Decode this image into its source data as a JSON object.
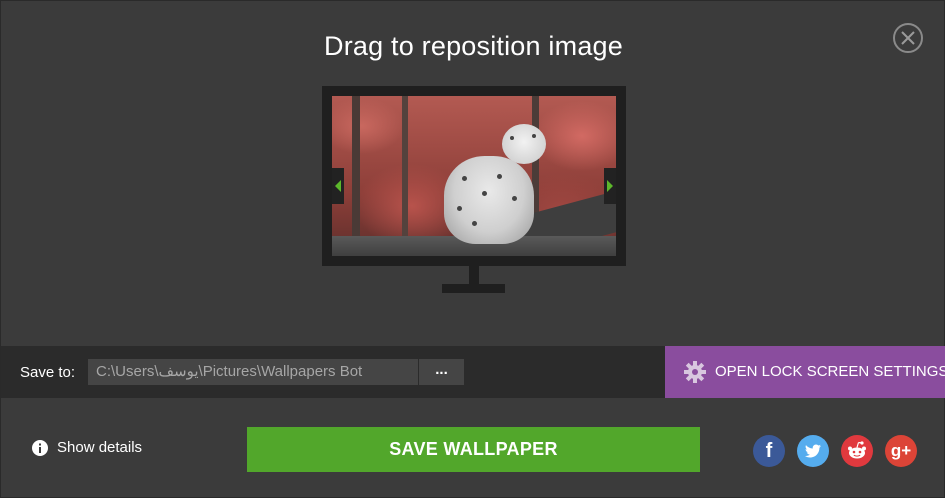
{
  "dialog": {
    "title": "Drag to reposition image"
  },
  "icons": {
    "close": "close-icon",
    "left_arrow": "chevron-left-icon",
    "right_arrow": "chevron-right-icon",
    "gear": "gear-icon",
    "info": "info-icon",
    "facebook": "facebook-icon",
    "twitter": "twitter-icon",
    "reddit": "reddit-icon",
    "google_plus": "google-plus-icon"
  },
  "save": {
    "label": "Save to:",
    "path": "C:\\Users\\يوسف\\Pictures\\Wallpapers Bot",
    "browse_label": "..."
  },
  "lock_screen": {
    "label": "OPEN LOCK SCREEN SETTINGS"
  },
  "details": {
    "label": "Show details"
  },
  "save_wallpaper": {
    "label": "SAVE WALLPAPER"
  },
  "social": {
    "facebook_glyph": "f",
    "google_plus_glyph": "g+"
  },
  "colors": {
    "accent_green": "#52a72b",
    "accent_purple": "#8a4d9e",
    "background": "#3b3b3b",
    "bar": "#2b2b2b",
    "arrow_green": "#5cb82b"
  }
}
